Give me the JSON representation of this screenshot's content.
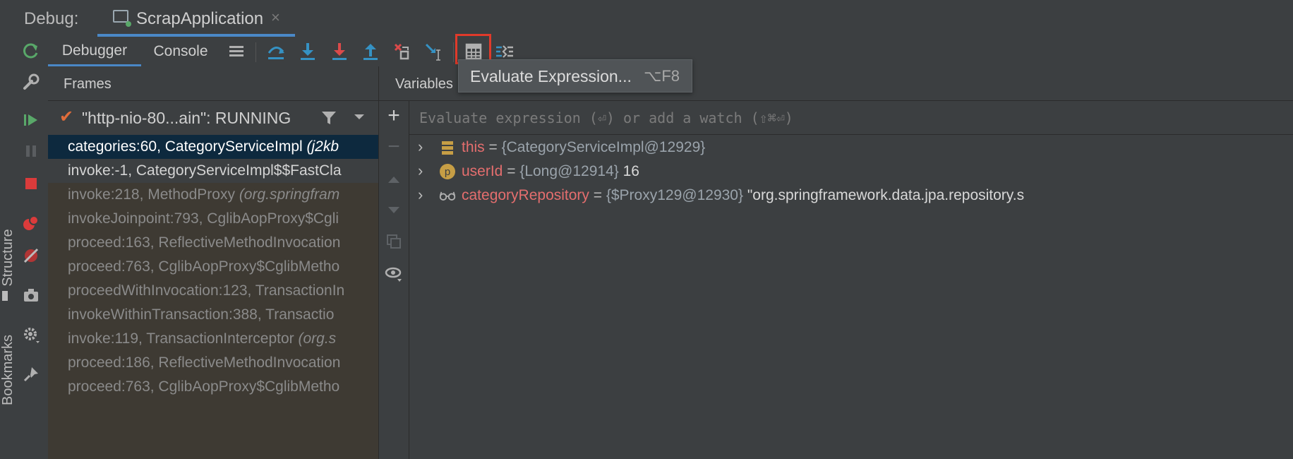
{
  "side_strip": {
    "labels": [
      "Structure",
      "Bookmarks"
    ]
  },
  "header": {
    "debug_label": "Debug:",
    "tab_title": "ScrapApplication",
    "tab_close": "×"
  },
  "left_toolbar": {
    "icons": [
      "rerun-icon",
      "settings-wrench-icon",
      "resume-icon",
      "pause-icon",
      "stop-icon",
      "view-breakpoints-icon",
      "mute-breakpoints-icon",
      "camera-icon",
      "gear-icon",
      "pin-icon"
    ]
  },
  "toolbar": {
    "tabs": [
      {
        "label": "Debugger"
      },
      {
        "label": "Console"
      }
    ],
    "buttons": [
      "threads-menu-icon",
      "step-over-icon",
      "step-into-icon",
      "force-step-into-icon",
      "step-out-icon",
      "drop-frame-icon",
      "run-to-cursor-icon",
      "evaluate-expression-icon",
      "trace-current-stream-icon"
    ]
  },
  "tooltip": {
    "text": "Evaluate Expression...",
    "shortcut": "⌥F8"
  },
  "frames": {
    "title": "Frames",
    "thread": "\"http-nio-80...ain\": RUNNING",
    "rows": [
      {
        "method": "categories:60, CategoryServiceImpl ",
        "pkg": "(j2kb",
        "kind": "sel"
      },
      {
        "method": "invoke:-1, CategoryServiceImpl$$FastCla",
        "pkg": "",
        "kind": "norm"
      },
      {
        "method": "invoke:218, MethodProxy ",
        "pkg": "(org.springfram",
        "kind": "lib"
      },
      {
        "method": "invokeJoinpoint:793, CglibAopProxy$Cgli",
        "pkg": "",
        "kind": "lib"
      },
      {
        "method": "proceed:163, ReflectiveMethodInvocation",
        "pkg": "",
        "kind": "lib"
      },
      {
        "method": "proceed:763, CglibAopProxy$CglibMetho",
        "pkg": "",
        "kind": "lib"
      },
      {
        "method": "proceedWithInvocation:123, TransactionIn",
        "pkg": "",
        "kind": "lib"
      },
      {
        "method": "invokeWithinTransaction:388, Transactio",
        "pkg": "",
        "kind": "lib"
      },
      {
        "method": "invoke:119, TransactionInterceptor ",
        "pkg": "(org.s",
        "kind": "lib"
      },
      {
        "method": "proceed:186, ReflectiveMethodInvocation",
        "pkg": "",
        "kind": "lib"
      },
      {
        "method": "proceed:763, CglibAopProxy$CglibMetho",
        "pkg": "",
        "kind": "lib"
      }
    ]
  },
  "variables": {
    "title": "Variables",
    "eval_placeholder": "Evaluate expression (⏎) or add a watch (⇧⌘⏎)",
    "rows": [
      {
        "name": "this",
        "eq": " = ",
        "type": "{CategoryServiceImpl@12929}",
        "value": "",
        "icon": "field-icon"
      },
      {
        "name": "userId",
        "eq": " = ",
        "type": "{Long@12914}",
        "value": " 16",
        "icon": "parameter-icon"
      },
      {
        "name": "categoryRepository",
        "eq": " = ",
        "type": "{$Proxy129@12930}",
        "value": " \"org.springframework.data.jpa.repository.s",
        "icon": "watch-glasses-icon"
      }
    ]
  },
  "colors": {
    "accent": "#4a88c7",
    "highlight_border": "#e03a2a",
    "selected_frame": "#0d293e",
    "library_frames": "#3e3a33",
    "var_name": "#e46e6e"
  }
}
